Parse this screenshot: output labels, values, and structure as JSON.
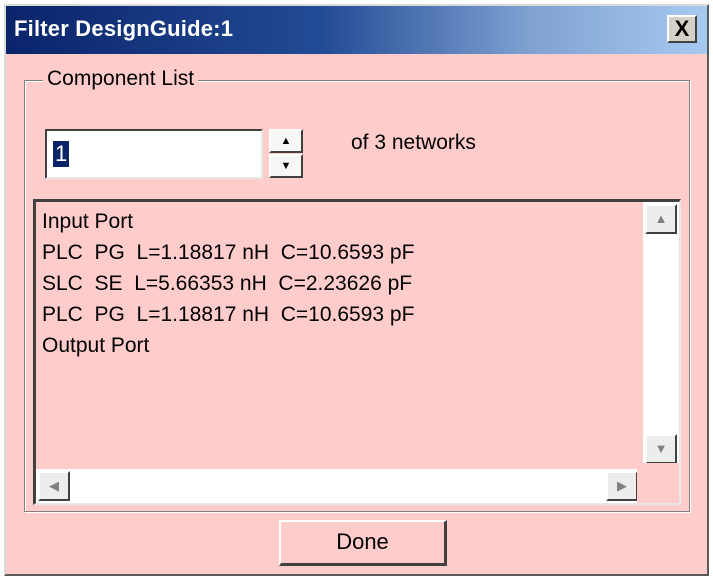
{
  "window": {
    "title": "Filter DesignGuide:1",
    "close_label": "X"
  },
  "component_list": {
    "group_label": "Component List",
    "spinner": {
      "value": "1",
      "up_glyph": "▲",
      "down_glyph": "▼"
    },
    "networks_label": "of 3 networks",
    "lines": [
      "Input Port",
      "PLC  PG  L=1.18817 nH  C=10.6593 pF",
      "SLC  SE  L=5.66353 nH  C=2.23626 pF",
      "PLC  PG  L=1.18817 nH  C=10.6593 pF",
      "Output Port"
    ],
    "scroll_glyphs": {
      "up": "▲",
      "down": "▼",
      "left": "◀",
      "right": "▶"
    }
  },
  "buttons": {
    "done_label": "Done"
  },
  "colors": {
    "dialog_bg": "#ffcccc",
    "title_start": "#0a246a",
    "title_end": "#a6caf0"
  }
}
